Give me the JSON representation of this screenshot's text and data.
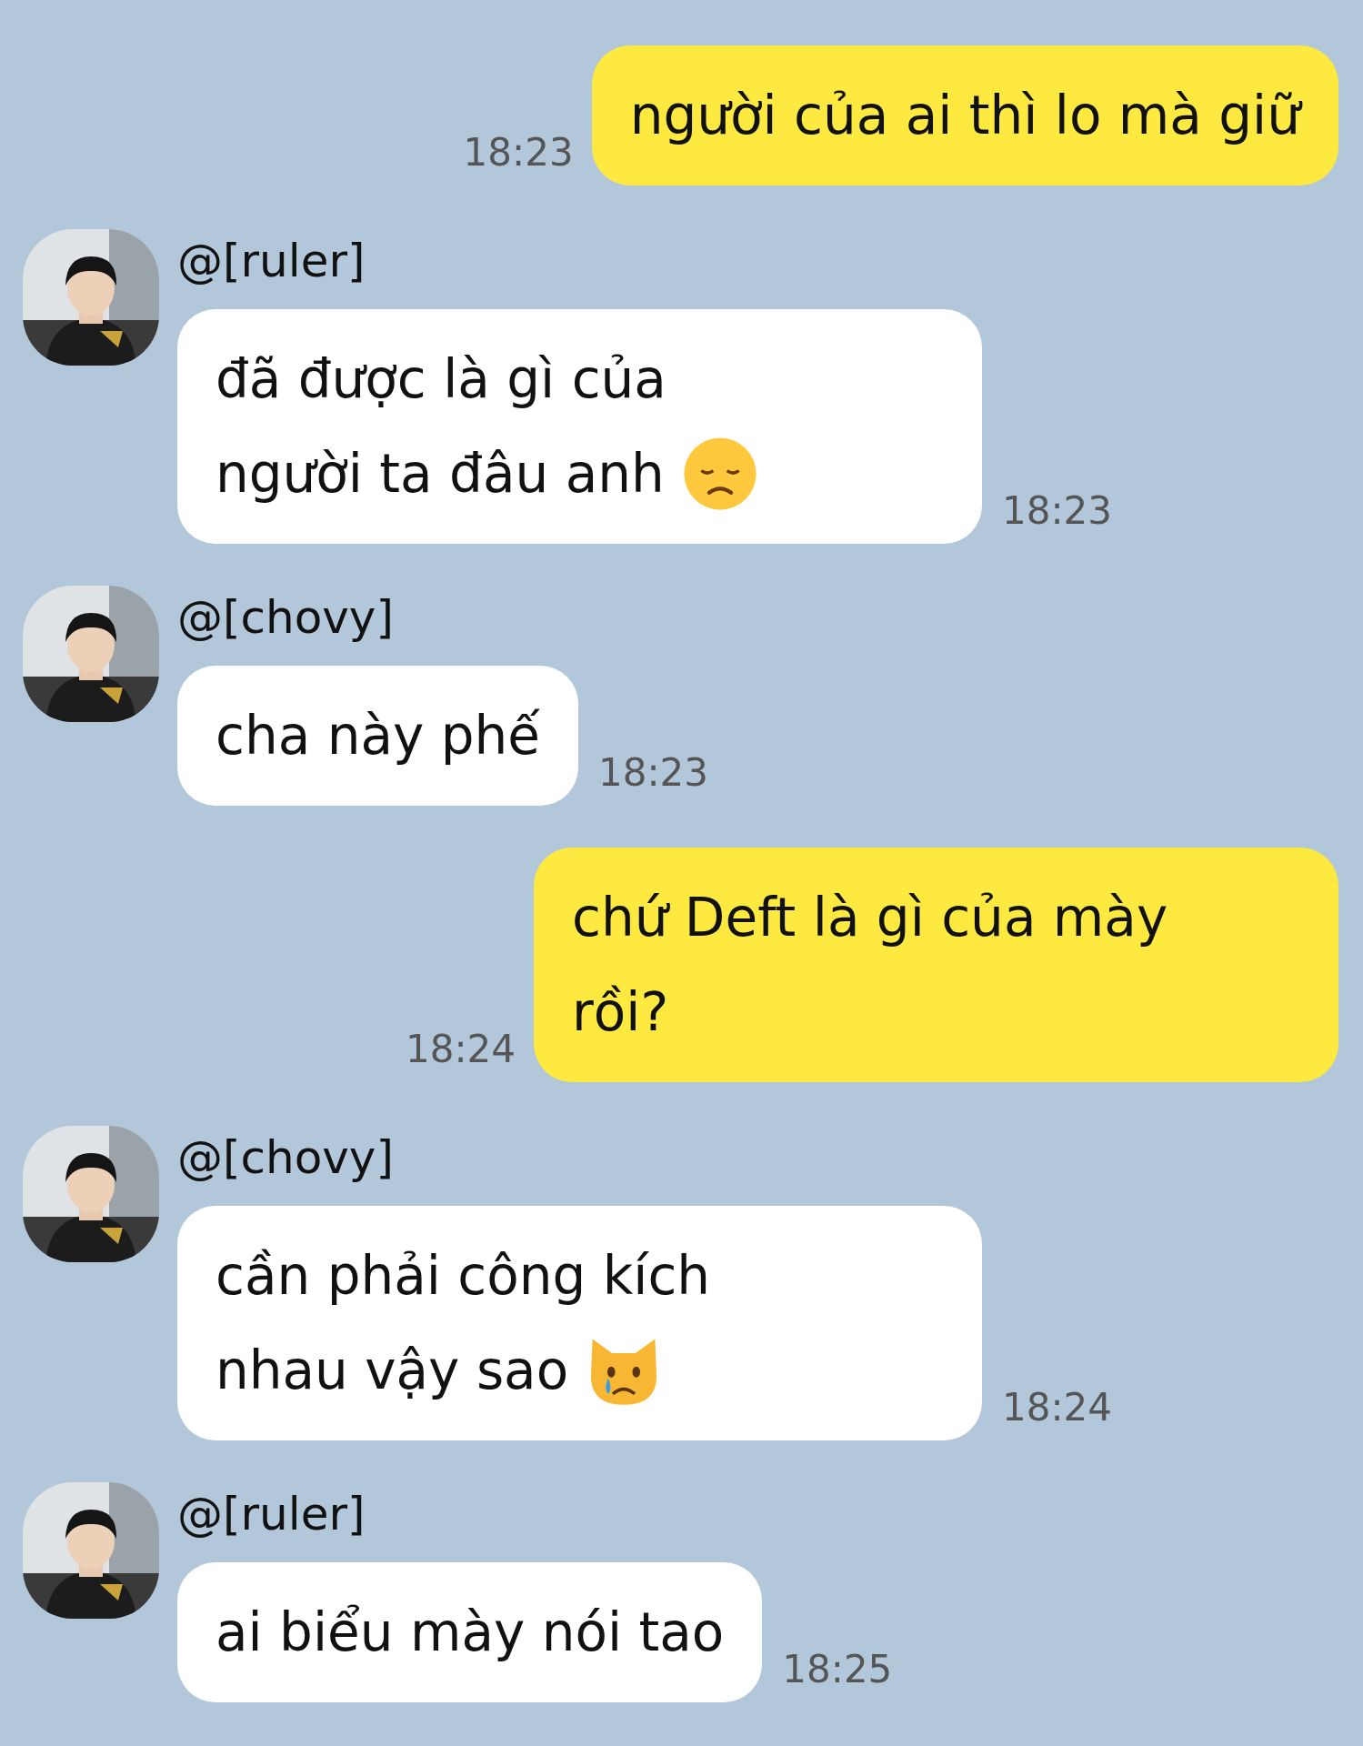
{
  "messages": [
    {
      "kind": "outgoing",
      "lines": [
        "người của ai thì lo mà giữ"
      ],
      "time": "18:23"
    },
    {
      "kind": "incoming",
      "sender": "@[ruler]",
      "avatar": {
        "kind": "picture"
      },
      "lines": [
        "đã được là gì của",
        "người ta đâu anh"
      ],
      "emoji": {
        "kind": "sad-face"
      },
      "time": "18:23"
    },
    {
      "kind": "incoming",
      "sender": "@[chovy]",
      "avatar": {
        "kind": "picture"
      },
      "lines": [
        "cha này phế"
      ],
      "time": "18:23"
    },
    {
      "kind": "outgoing",
      "lines": [
        "chứ Deft là gì của mày",
        "rồi?"
      ],
      "time": "18:24"
    },
    {
      "kind": "incoming",
      "sender": "@[chovy]",
      "avatar": {
        "kind": "picture"
      },
      "lines": [
        "cần phải công kích",
        "nhau vậy sao"
      ],
      "emoji": {
        "kind": "crying-cat"
      },
      "time": "18:24"
    },
    {
      "kind": "incoming",
      "sender": "@[ruler]",
      "avatar": {
        "kind": "picture"
      },
      "lines": [
        "ai biểu mày nói tao"
      ],
      "time": "18:25"
    }
  ]
}
